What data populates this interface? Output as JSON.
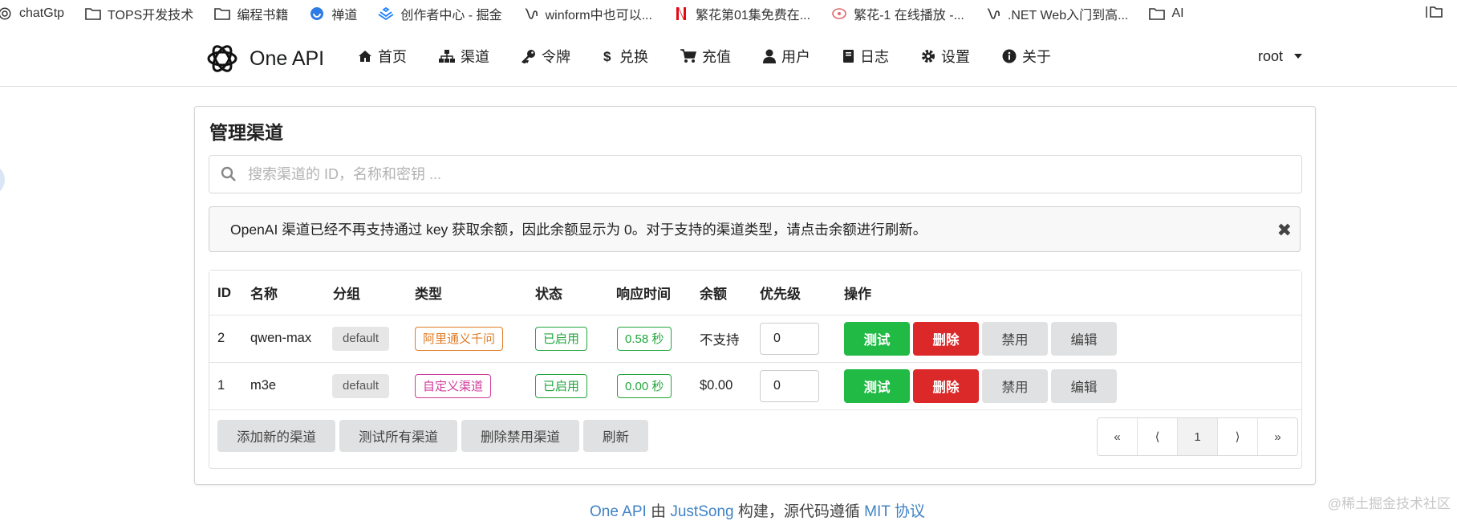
{
  "bookmarks": [
    {
      "label": "chatGtp",
      "icon": "openai-icon"
    },
    {
      "label": "TOPS开发技术",
      "icon": "folder-icon"
    },
    {
      "label": "编程书籍",
      "icon": "folder-icon"
    },
    {
      "label": "禅道",
      "icon": "zentao-icon"
    },
    {
      "label": "创作者中心 - 掘金",
      "icon": "juejin-icon"
    },
    {
      "label": "winform中也可以...",
      "icon": "bookmark-icon"
    },
    {
      "label": "繁花第01集免费在...",
      "icon": "netflix-icon"
    },
    {
      "label": "繁花-1 在线播放 -...",
      "icon": "video-icon"
    },
    {
      "label": ".NET Web入门到高...",
      "icon": "bookmark-icon"
    },
    {
      "label": "AI",
      "icon": "folder-icon"
    }
  ],
  "brand": {
    "name": "One API"
  },
  "nav": [
    {
      "label": "首页",
      "icon": "home-icon"
    },
    {
      "label": "渠道",
      "icon": "sitemap-icon"
    },
    {
      "label": "令牌",
      "icon": "key-icon"
    },
    {
      "label": "兑换",
      "icon": "dollar-icon"
    },
    {
      "label": "充值",
      "icon": "cart-icon"
    },
    {
      "label": "用户",
      "icon": "user-icon"
    },
    {
      "label": "日志",
      "icon": "book-icon"
    },
    {
      "label": "设置",
      "icon": "gear-icon"
    },
    {
      "label": "关于",
      "icon": "info-icon"
    }
  ],
  "user": {
    "name": "root"
  },
  "page": {
    "title": "管理渠道"
  },
  "search": {
    "placeholder": "搜索渠道的 ID，名称和密钥 ..."
  },
  "notice": {
    "text": "OpenAI 渠道已经不再支持通过 key 获取余额，因此余额显示为 0。对于支持的渠道类型，请点击余额进行刷新。",
    "close": "✖"
  },
  "table": {
    "headers": {
      "id": "ID",
      "name": "名称",
      "group": "分组",
      "type": "类型",
      "status": "状态",
      "response": "响应时间",
      "balance": "余额",
      "priority": "优先级",
      "actions": "操作"
    },
    "rows": [
      {
        "id": "2",
        "name": "qwen-max",
        "group": "default",
        "type": "阿里通义千问",
        "status": "已启用",
        "response": "0.58 秒",
        "balance": "不支持",
        "priority": "0"
      },
      {
        "id": "1",
        "name": "m3e",
        "group": "default",
        "type": "自定义渠道",
        "status": "已启用",
        "response": "0.00 秒",
        "balance": "$0.00",
        "priority": "0"
      }
    ],
    "actions": {
      "test": "测试",
      "delete": "删除",
      "disable": "禁用",
      "edit": "编辑"
    }
  },
  "footer_buttons": {
    "add": "添加新的渠道",
    "test_all": "测试所有渠道",
    "delete_disabled": "删除禁用渠道",
    "refresh": "刷新"
  },
  "pagination": {
    "first": "«",
    "prev": "⟨",
    "current": "1",
    "next": "⟩",
    "last": "»"
  },
  "page_footer": {
    "product": "One API",
    "by": "由",
    "author": "JustSong",
    "built": "构建，源代码遵循",
    "license": "MIT 协议"
  },
  "watermark": "@稀土掘金技术社区",
  "colors": {
    "green": "#21ba45",
    "red": "#db2828",
    "grey": "#e0e1e2",
    "link": "#4183c4",
    "orange": "#e07b24",
    "pink": "#d03d9b"
  }
}
